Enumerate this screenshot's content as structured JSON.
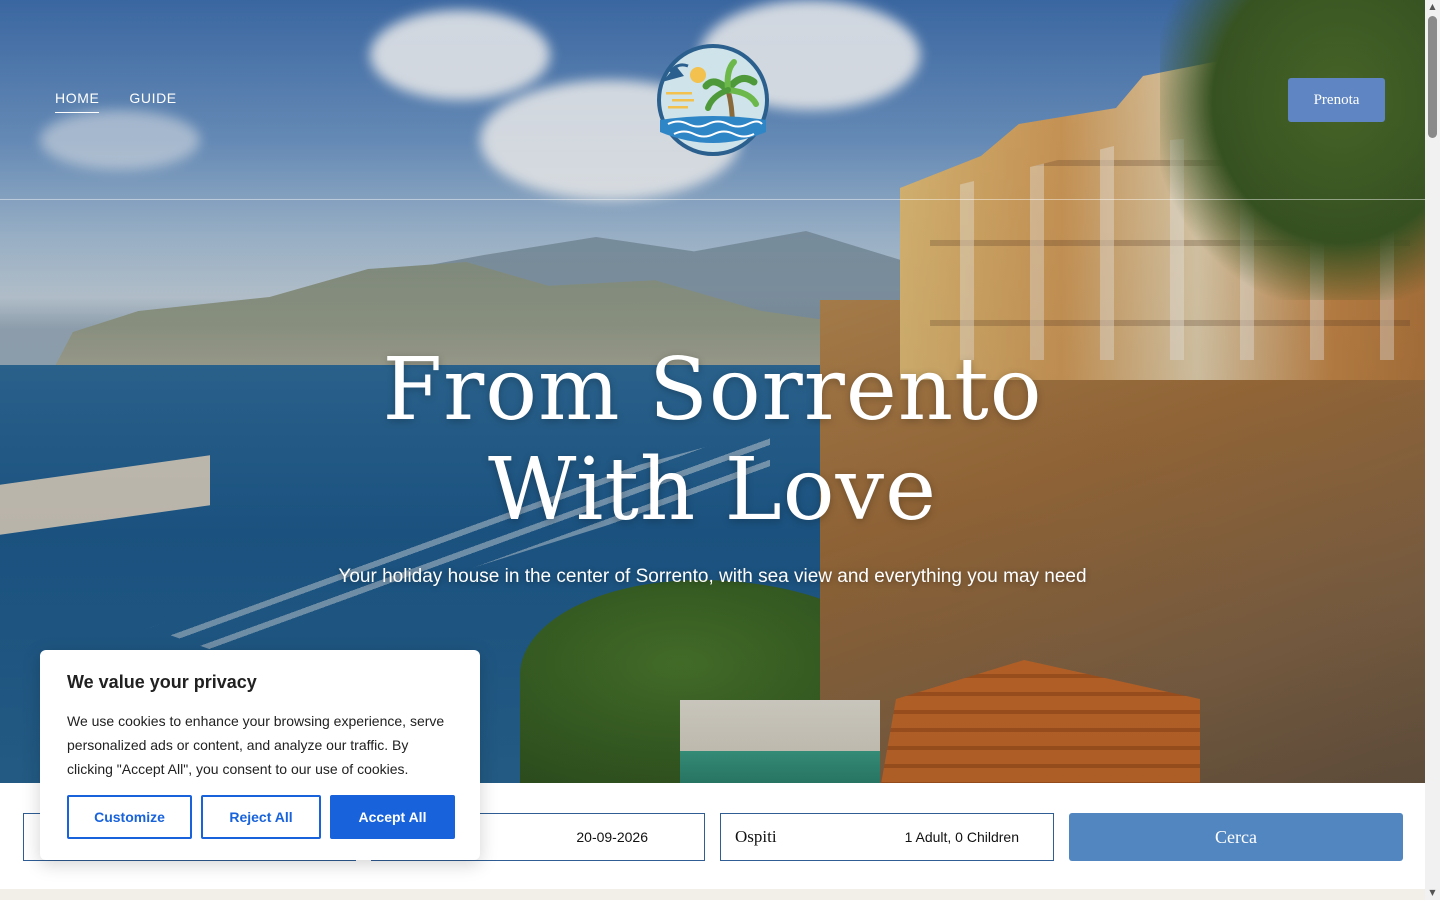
{
  "header": {
    "nav": [
      {
        "label": "HOME",
        "active": true
      },
      {
        "label": "GUIDE",
        "active": false
      }
    ],
    "book_button": "Prenota",
    "logo_icon": "palm-sun-sea-logo"
  },
  "hero": {
    "title_line1": "From Sorrento",
    "title_line2": "With Love",
    "subtitle": "Your holiday house in the center of Sorrento, with sea view and everything you may need"
  },
  "search": {
    "checkout_value": "20-09-2026",
    "guests_label": "Ospiti",
    "guests_value": "1 Adult, 0 Children",
    "submit_label": "Cerca"
  },
  "cookie_banner": {
    "title": "We value your privacy",
    "text": "We use cookies to enhance your browsing experience, serve personalized ads or content, and analyze our traffic. By clicking \"Accept All\", you consent to our use of cookies.",
    "customize_label": "Customize",
    "reject_label": "Reject All",
    "accept_label": "Accept All"
  },
  "colors": {
    "accent": "#5f86c2",
    "search_button": "#5286c1",
    "cookie_primary": "#1863dc",
    "field_border": "#2f5d94"
  }
}
